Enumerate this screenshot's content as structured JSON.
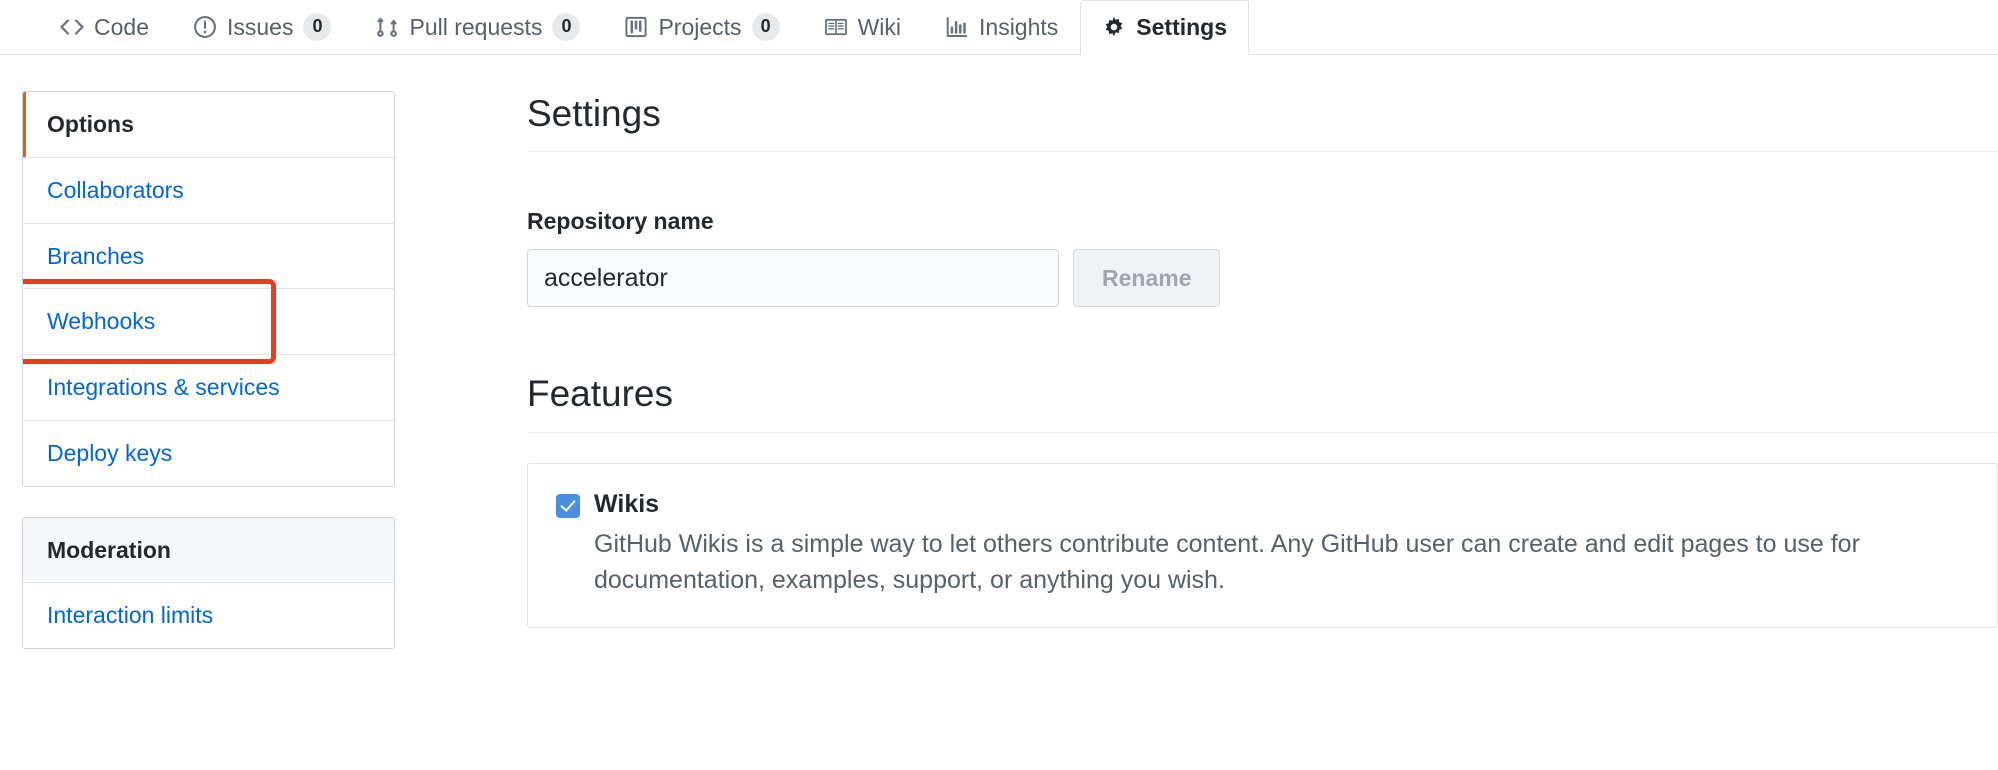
{
  "repo_nav": {
    "tabs": [
      {
        "label": "Code",
        "icon": "code-icon",
        "count": null,
        "active": false
      },
      {
        "label": "Issues",
        "icon": "issue-icon",
        "count": "0",
        "active": false
      },
      {
        "label": "Pull requests",
        "icon": "git-pull-icon",
        "count": "0",
        "active": false
      },
      {
        "label": "Projects",
        "icon": "project-icon",
        "count": "0",
        "active": false
      },
      {
        "label": "Wiki",
        "icon": "book-icon",
        "count": null,
        "active": false
      },
      {
        "label": "Insights",
        "icon": "graph-icon",
        "count": null,
        "active": false
      },
      {
        "label": "Settings",
        "icon": "gear-icon",
        "count": null,
        "active": true
      }
    ]
  },
  "sidebar": {
    "menus": [
      {
        "heading": "Options",
        "heading_selected": true,
        "heading_gray": false,
        "items": [
          {
            "label": "Collaborators",
            "highlighted": false
          },
          {
            "label": "Branches",
            "highlighted": false
          },
          {
            "label": "Webhooks",
            "highlighted": true
          },
          {
            "label": "Integrations & services",
            "highlighted": false
          },
          {
            "label": "Deploy keys",
            "highlighted": false
          }
        ]
      },
      {
        "heading": "Moderation",
        "heading_selected": false,
        "heading_gray": true,
        "items": [
          {
            "label": "Interaction limits",
            "highlighted": false
          }
        ]
      }
    ]
  },
  "main": {
    "title": "Settings",
    "repository_name": {
      "label": "Repository name",
      "value": "accelerator",
      "placeholder": "Repository name",
      "rename_button": "Rename",
      "rename_disabled": true
    },
    "features": {
      "title": "Features",
      "items": [
        {
          "name": "Wikis",
          "checked": true,
          "description": "GitHub Wikis is a simple way to let others contribute content. Any GitHub user can create and edit pages to use for\ndocumentation, examples, support, or anything you wish."
        }
      ]
    }
  },
  "annotation": {
    "color": "#ee3b1e",
    "target": "Webhooks"
  },
  "colors": {
    "link": "#0366d6",
    "selected_marker": "#e36209",
    "checkbox": "#4a90e2",
    "border": "#e1e4e8",
    "text": "#24292e",
    "muted": "#586069"
  }
}
